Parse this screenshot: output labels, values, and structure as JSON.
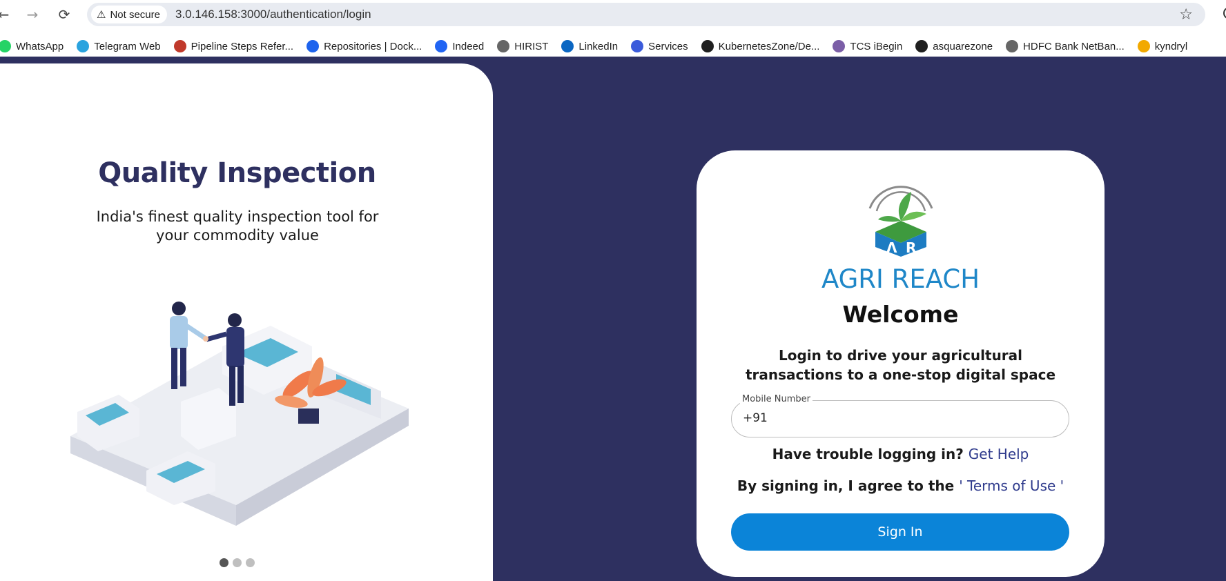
{
  "browser": {
    "security_label": "Not secure",
    "url": "3.0.146.158:3000/authentication/login",
    "bookmarks": [
      {
        "label": "WhatsApp",
        "icon": "whatsapp-icon",
        "color": "#25d366"
      },
      {
        "label": "Telegram Web",
        "icon": "telegram-icon",
        "color": "#2aa3df"
      },
      {
        "label": "Pipeline Steps Refer...",
        "icon": "jenkins-icon",
        "color": "#c0392b"
      },
      {
        "label": "Repositories | Dock...",
        "icon": "docker-icon",
        "color": "#1d63ed"
      },
      {
        "label": "Indeed",
        "icon": "indeed-icon",
        "color": "#2164f3"
      },
      {
        "label": "HIRIST",
        "icon": "globe-icon",
        "color": "#666666"
      },
      {
        "label": "LinkedIn",
        "icon": "linkedin-icon",
        "color": "#0a66c2"
      },
      {
        "label": "Services",
        "icon": "services-icon",
        "color": "#3b5bdb"
      },
      {
        "label": "KubernetesZone/De...",
        "icon": "github-icon",
        "color": "#1f1f1f"
      },
      {
        "label": "TCS iBegin",
        "icon": "tcs-icon",
        "color": "#7b5ea7"
      },
      {
        "label": "asquarezone",
        "icon": "github-icon",
        "color": "#1f1f1f"
      },
      {
        "label": "HDFC Bank NetBan...",
        "icon": "globe-icon",
        "color": "#666666"
      },
      {
        "label": "kyndryl",
        "icon": "kyndryl-icon",
        "color": "#f2a900"
      }
    ]
  },
  "hero": {
    "title": "Quality Inspection",
    "subtitle": "India's finest quality inspection tool for your commodity value",
    "slides": 3,
    "active_slide": 0
  },
  "login": {
    "brand": "AGRI REACH",
    "welcome": "Welcome",
    "tagline": "Login to drive your agricultural transactions to a one-stop digital space",
    "mobile_label": "Mobile Number",
    "mobile_prefix": "+91",
    "mobile_value": "",
    "trouble_text": "Have trouble logging in?",
    "help_link": "Get Help",
    "terms_text": "By signing in, I agree to the",
    "terms_link": "' Terms of Use '",
    "signin_label": "Sign In"
  },
  "colors": {
    "page_bg": "#2e3060",
    "brand": "#1f87c8",
    "primary_button": "#0b84d8",
    "link": "#2e3a8c"
  }
}
